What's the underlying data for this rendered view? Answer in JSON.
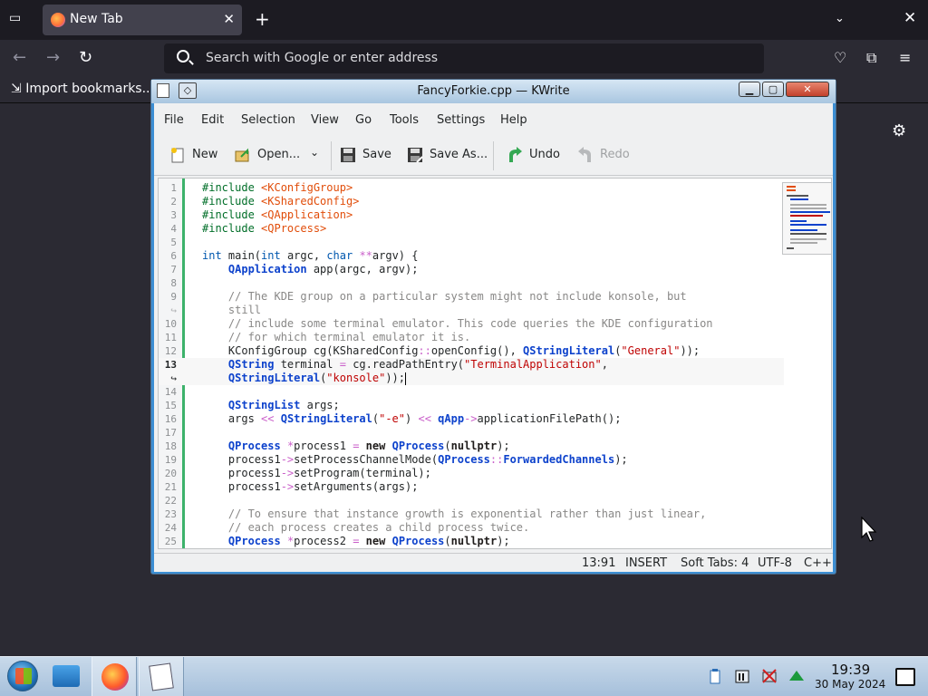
{
  "browser": {
    "tab_title": "New Tab",
    "url_placeholder": "Search with Google or enter address",
    "bookmark_label": "Import bookmarks..."
  },
  "window": {
    "title": "FancyForkie.cpp — KWrite",
    "controls": [
      "minimize",
      "maximize",
      "close"
    ]
  },
  "menubar": {
    "items": [
      "File",
      "Edit",
      "Selection",
      "View",
      "Go",
      "Tools",
      "Settings",
      "Help"
    ]
  },
  "toolbar": {
    "new_label": "New",
    "open_label": "Open...",
    "save_label": "Save",
    "save_as_label": "Save As...",
    "undo_label": "Undo",
    "redo_label": "Redo"
  },
  "editor": {
    "line_numbers": [
      "1",
      "2",
      "3",
      "4",
      "5",
      "6",
      "7",
      "8",
      "9",
      "↪",
      "10",
      "11",
      "12",
      "13",
      "↪",
      "14",
      "15",
      "16",
      "17",
      "18",
      "19",
      "20",
      "21",
      "22",
      "23",
      "24",
      "25"
    ],
    "current_line": "13"
  },
  "status": {
    "position": "13:91",
    "mode": "INSERT",
    "indent": "Soft Tabs: 4",
    "encoding": "UTF-8",
    "language": "C++"
  },
  "taskbar": {
    "time": "19:39",
    "date": "30 May 2024"
  },
  "colors": {
    "titlebar": "#a9c6e0",
    "taskbar": "#b7cde3",
    "modified_marker": "#3db26b"
  }
}
